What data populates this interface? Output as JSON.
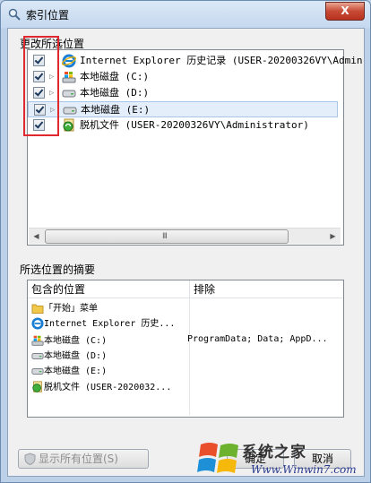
{
  "window": {
    "title": "索引位置",
    "close_label": "X"
  },
  "change_group": {
    "label": "更改所选位置",
    "items": [
      {
        "text": "Internet Explorer 历史记录 (USER-20200326VY\\Admin",
        "checked": true,
        "expandable": false,
        "icon": "internet-explorer-icon"
      },
      {
        "text": "本地磁盘 (C:)",
        "checked": true,
        "expandable": true,
        "icon": "windows-drive-icon"
      },
      {
        "text": "本地磁盘 (D:)",
        "checked": true,
        "expandable": true,
        "icon": "drive-icon"
      },
      {
        "text": "本地磁盘 (E:)",
        "checked": true,
        "expandable": true,
        "icon": "drive-icon",
        "selected": true
      },
      {
        "text": "脱机文件 (USER-20200326VY\\Administrator)",
        "checked": true,
        "expandable": false,
        "icon": "offline-files-icon"
      }
    ],
    "scrollbar_grip": "III"
  },
  "summary_group": {
    "label": "所选位置的摘要",
    "columns": {
      "included": "包含的位置",
      "excluded": "排除"
    },
    "rows": [
      {
        "included": "「开始」菜单",
        "excluded": "",
        "icon": "folder-icon"
      },
      {
        "included": "Internet Explorer 历史...",
        "excluded": "",
        "icon": "internet-explorer-icon"
      },
      {
        "included": "本地磁盘 (C:)",
        "excluded": "ProgramData; Data; AppD...",
        "icon": "windows-drive-icon"
      },
      {
        "included": "本地磁盘 (D:)",
        "excluded": "",
        "icon": "drive-icon"
      },
      {
        "included": "本地磁盘 (E:)",
        "excluded": "",
        "icon": "drive-icon"
      },
      {
        "included": "脱机文件 (USER-2020032...",
        "excluded": "",
        "icon": "offline-files-icon"
      }
    ]
  },
  "buttons": {
    "show_all": "显示所有位置(S)",
    "ok": "确定",
    "cancel": "取消"
  },
  "watermark": {
    "title": "系统之家",
    "url": "Www.Winwin7.com"
  },
  "colors": {
    "highlight_box": "#e0282f",
    "selection": "#e3eefa",
    "close_button": "#c74a35"
  }
}
